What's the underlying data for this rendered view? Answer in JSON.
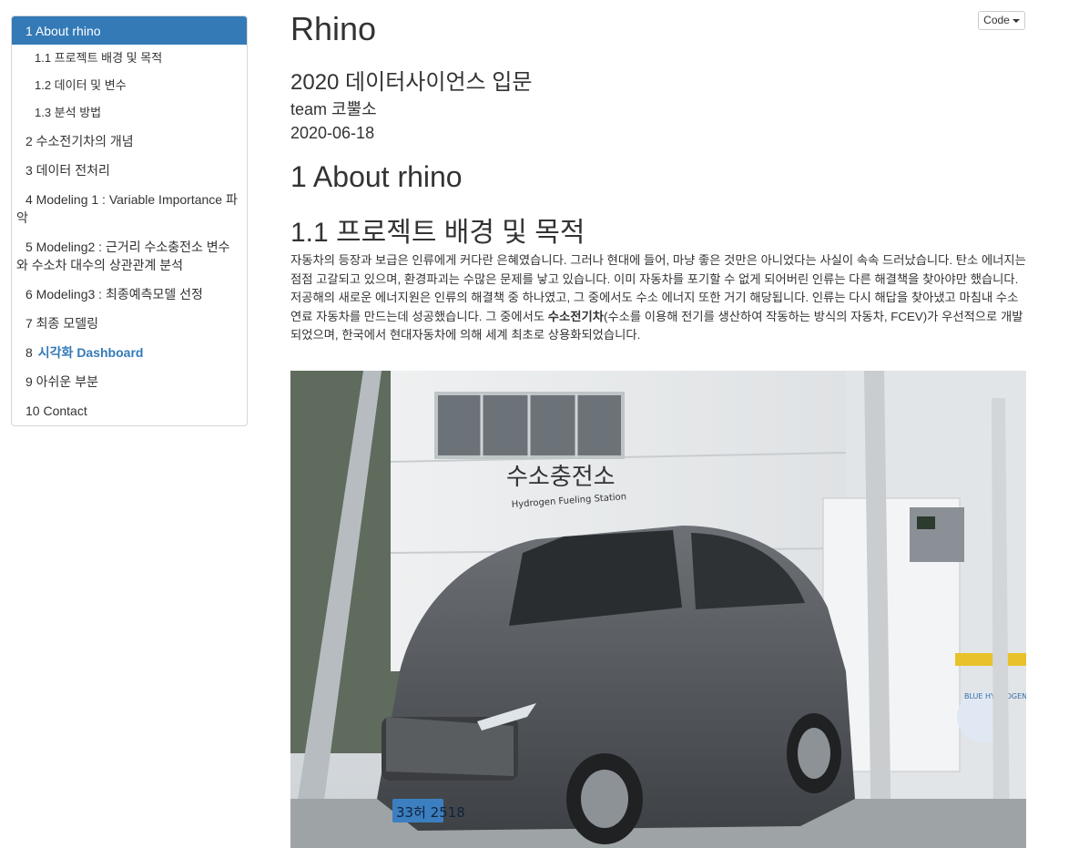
{
  "toc": {
    "items": [
      {
        "label": "1 About rhino"
      },
      {
        "label": "1.1 프로젝트 배경 및 목적"
      },
      {
        "label": "1.2 데이터 및 변수"
      },
      {
        "label": "1.3 분석 방법"
      },
      {
        "label": "2 수소전기차의 개념"
      },
      {
        "label": "3 데이터 전처리"
      },
      {
        "label": "4 Modeling 1 : Variable Importance 파악"
      },
      {
        "label": "5 Modeling2 : 근거리 수소충전소 변수와 수소차 대수의 상관관계 분석"
      },
      {
        "label": "6 Modeling3 : 최종예측모델 선정"
      },
      {
        "label": "7 최종 모델링"
      },
      {
        "label_num": "8",
        "label_hl": "시각화 Dashboard"
      },
      {
        "label": "9 아쉬운 부분"
      },
      {
        "label": "10 Contact"
      }
    ]
  },
  "code_button": {
    "label": "Code"
  },
  "header": {
    "title": "Rhino",
    "subtitle": "2020 데이터사이언스 입문",
    "author": "team 코뿔소",
    "date": "2020-06-18"
  },
  "content": {
    "h1": "1 About rhino",
    "h2": "1.1 프로젝트 배경 및 목적",
    "para_1": "자동차의 등장과 보급은 인류에게 커다란 은혜였습니다. 그러나 현대에 들어, 마냥 좋은 것만은 아니었다는 사실이 속속 드러났습니다. 탄소 에너지는 점점 고갈되고 있으며, 환경파괴는 수많은 문제를 낳고 있습니다. 이미 자동차를 포기할 수 없게 되어버린 인류는 다른 해결책을 찾아야만 했습니다. 저공해의 새로운 에너지원은 인류의 해결책 중 하나였고, 그 중에서도 수소 에너지 또한 거기 해당됩니다. 인류는 다시 해답을 찾아냈고 마침내 수소연료 자동차를 만드는데 성공했습니다. 그 중에서도 ",
    "para_bold": "수소전기차",
    "para_2": "(수소를 이용해 전기를 생산하여 작동하는 방식의 자동차, FCEV)가 우선적으로 개발되었으며, 한국에서 현대자동차에 의해 세계 최초로 상용화되었습니다."
  },
  "photo": {
    "station_sign": "수소충전소",
    "station_sign_en": "Hydrogen Fueling Station",
    "plate": "33허 2518",
    "banner": "BLUE HYDROGEN"
  }
}
